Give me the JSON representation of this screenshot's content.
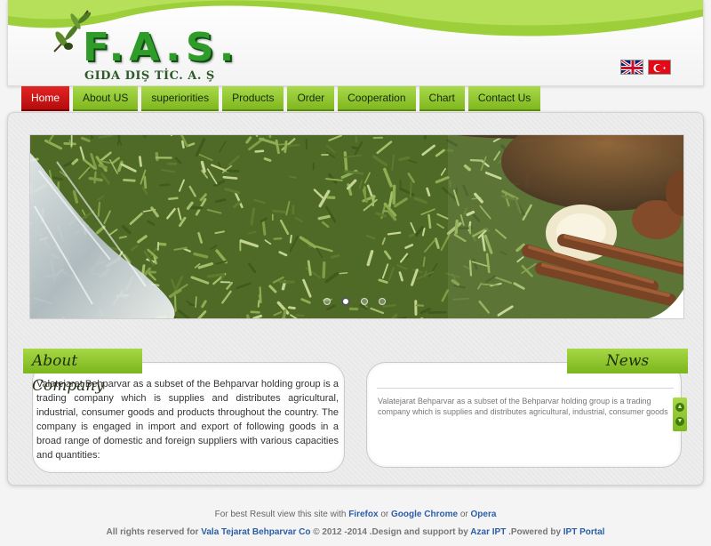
{
  "header": {
    "logo_title": "F.A.S.",
    "logo_subtitle": "GIDA DIŞ TİC. A. Ş",
    "languages": [
      "English",
      "Türkçe"
    ]
  },
  "nav": {
    "items": [
      "Home",
      "About US",
      "superiorities",
      "Products",
      "Order",
      "Cooperation",
      "Chart",
      "Contact Us"
    ],
    "active": "Home"
  },
  "slider": {
    "slide_count": 4,
    "active_slide": 2
  },
  "about": {
    "title": "About Company",
    "text": "Valatejarat Behparvar as a subset of the Behparvar holding group is a trading company which is supplies and distributes agricultural, industrial, consumer goods and products throughout the country. The company is engaged in import and export of following goods in a broad range of domestic and foreign suppliers with various capacities and quantities:"
  },
  "news": {
    "title": "News",
    "text": "Valatejarat Behparvar as a subset of the Behparvar holding group is a trading company which is supplies and distributes agricultural, industrial, consumer goods"
  },
  "footer": {
    "browsers_prefix": "For best Result view this site with",
    "browser1": "Firefox",
    "or1": "or",
    "browser2": "Google Chrome",
    "or2": "or",
    "browser3": "Opera",
    "rights_prefix": "All rights reserved for",
    "company": "Vala Tejarat Behparvar Co",
    "years": "© 2012 -2014",
    "design_prefix": ".Design and support by",
    "designer": "Azar IPT",
    "powered_prefix": ".Powered by",
    "powered": "IPT Portal"
  },
  "colors": {
    "accent_green": "#8cc63f",
    "active_red": "#d11414",
    "link_blue": "#2a5fa8"
  }
}
